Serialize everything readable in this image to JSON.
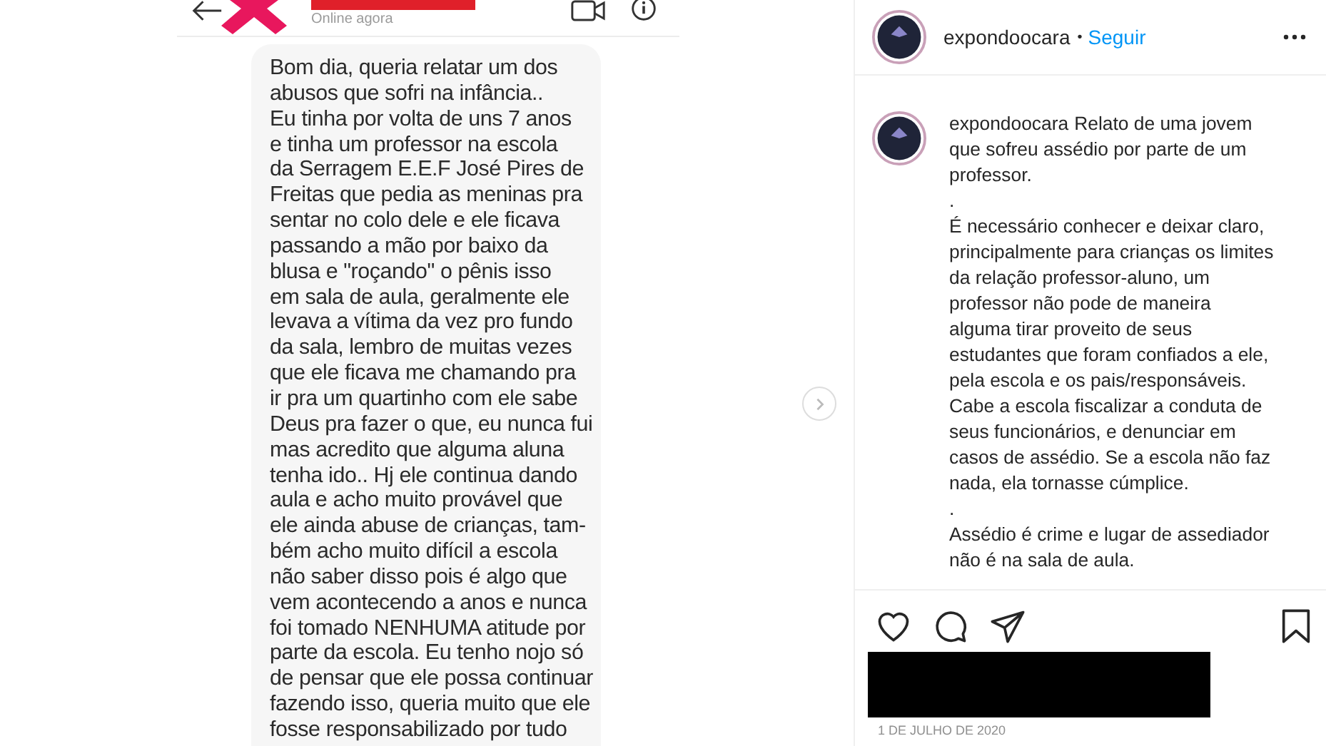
{
  "chat": {
    "status": "Online agora",
    "message_lines": [
      "Bom dia, queria relatar um dos",
      "abusos que sofri na infância..",
      "Eu tinha por volta de uns 7 anos",
      "e tinha um professor na escola",
      "da Serragem E.E.F José Pires de",
      "Freitas que pedia as meninas pra",
      "sentar no colo dele e ele ficava",
      "passando a mão por baixo da",
      "blusa e \"roçando\" o pênis isso",
      "em sala de aula, geralmente ele",
      "levava a vítima da vez pro fundo",
      "da sala, lembro de muitas vezes",
      "que ele ficava me chamando pra",
      "ir pra um quartinho com ele sabe",
      "Deus pra fazer o que, eu nunca fui",
      "mas acredito que alguma aluna",
      "tenha ido.. Hj ele continua dando",
      "aula e acho muito provável que",
      "ele ainda abuse de crianças, tam-",
      "bém acho muito difícil a escola",
      "não saber disso pois é algo que",
      "vem acontecendo a anos e nunca",
      "foi tomado NENHUMA atitude por",
      "parte da escola. Eu tenho nojo só",
      "de pensar que ele possa continuar",
      "fazendo isso, queria muito que ele",
      "fosse responsabilizado por tudo"
    ]
  },
  "header": {
    "username": "expondoocara",
    "separator": "•",
    "follow": "Seguir"
  },
  "caption": {
    "username": "expondoocara",
    "lines": [
      "Relato de uma jovem",
      "que sofreu assédio por parte de um",
      "professor.",
      ".",
      "É necessário conhecer e deixar claro,",
      "principalmente para crianças os limites",
      "da relação professor-aluno, um",
      "professor não pode de maneira",
      "alguma tirar proveito de seus",
      "estudantes que foram confiados a ele,",
      "pela escola e os pais/responsáveis.",
      "Cabe a escola fiscalizar a conduta de",
      "seus funcionários, e denunciar em",
      "casos de assédio. Se a escola não faz",
      "nada, ela tornasse cúmplice.",
      ".",
      "Assédio é crime e lugar de assediador",
      "não é na sala de aula."
    ]
  },
  "date": "1 DE JULHO DE 2020"
}
